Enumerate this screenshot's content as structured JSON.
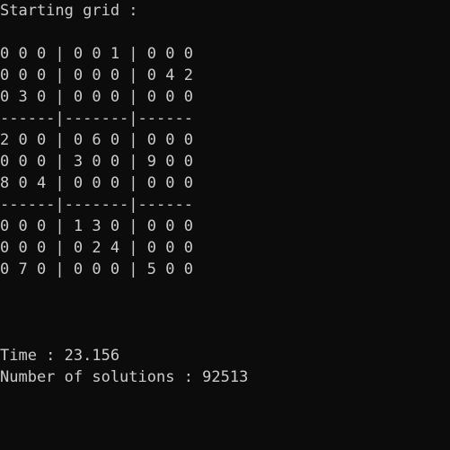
{
  "console": {
    "title": "Starting grid :",
    "grid_rows": [
      "0 0 0 | 0 0 1 | 0 0 0",
      "0 0 0 | 0 0 0 | 0 4 2",
      "0 3 0 | 0 0 0 | 0 0 0",
      "------|-------|------",
      "2 0 0 | 0 6 0 | 0 0 0",
      "0 0 0 | 3 0 0 | 9 0 0",
      "8 0 4 | 0 0 0 | 0 0 0",
      "------|-------|------",
      "0 0 0 | 1 3 0 | 0 0 0",
      "0 0 0 | 0 2 4 | 0 0 0",
      "0 7 0 | 0 0 0 | 5 0 0"
    ],
    "time_line": "Time : 23.156",
    "solutions_line": "Number of solutions : 92513"
  },
  "colors": {
    "background": "#0c0c0c",
    "text": "#cccccc"
  }
}
